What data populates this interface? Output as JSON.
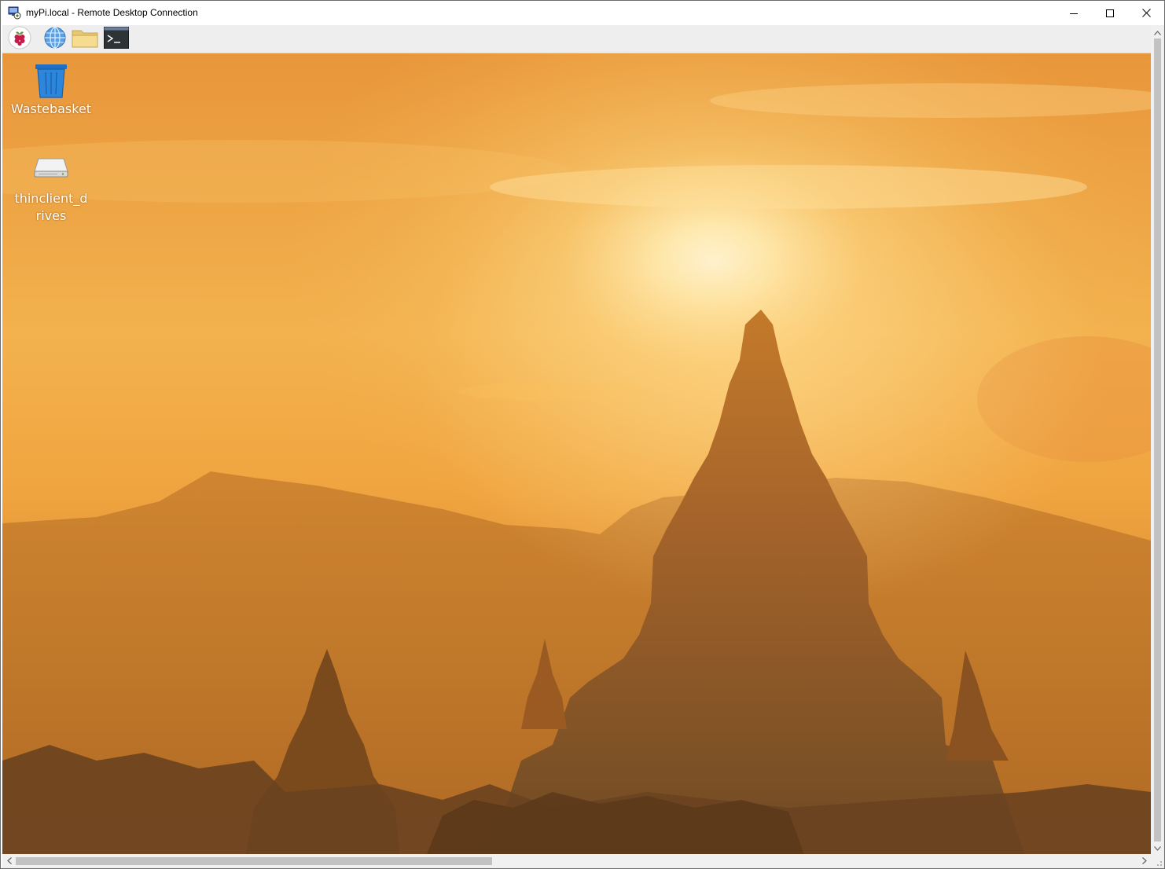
{
  "window": {
    "title": "myPi.local - Remote Desktop Connection",
    "controls": {
      "minimize": "minimize-icon",
      "maximize": "maximize-icon",
      "close": "close-icon"
    }
  },
  "panel": {
    "launchers": [
      {
        "icon": "raspberry-menu-icon"
      },
      {
        "icon": "web-browser-icon"
      },
      {
        "icon": "file-manager-icon"
      },
      {
        "icon": "terminal-icon"
      }
    ]
  },
  "desktop": {
    "icons": [
      {
        "label": "Wastebasket",
        "icon": "wastebasket-icon"
      },
      {
        "label": "thinclient_drives",
        "icon": "drive-icon"
      }
    ],
    "wallpaper": "sunset-pagoda-wallpaper"
  },
  "colors": {
    "panel": "#eeeeee",
    "sky_top": "#e89a3c",
    "sun": "#fff6d6",
    "silhouette": "#7a4a1a"
  }
}
